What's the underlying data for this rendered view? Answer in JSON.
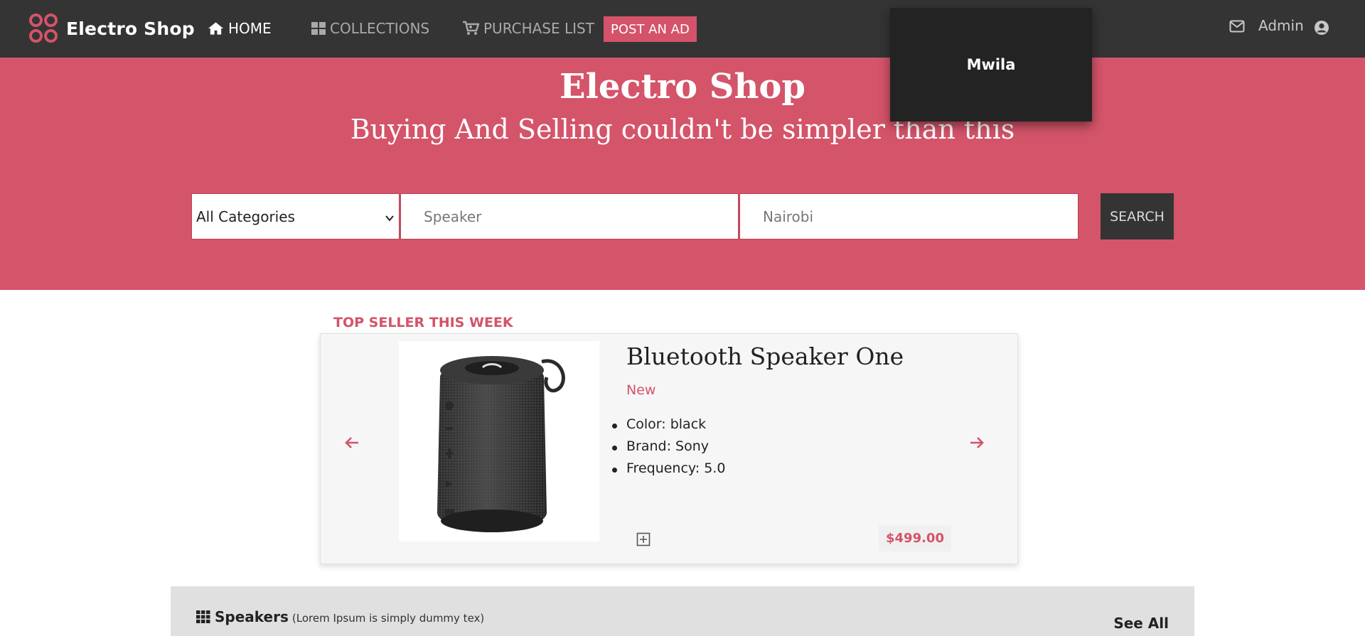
{
  "colors": {
    "accent": "#d4536a",
    "navbar": "#343434",
    "popup": "#232323"
  },
  "brand": {
    "name": "Electro Shop",
    "logo_icon": "four-circles-logo"
  },
  "nav": {
    "home": {
      "label": "HOME",
      "icon": "home-icon"
    },
    "collections": {
      "label": "COLLECTIONS",
      "icon": "grid-icon"
    },
    "purchase_list": {
      "label": "PURCHASE LIST",
      "icon": "cart-icon"
    },
    "post_ad": "POST AN AD",
    "admin": "Admin",
    "mail_icon": "mail-icon",
    "user_icon": "user-circle-icon"
  },
  "user_popup": {
    "name": "Mwila"
  },
  "hero": {
    "title": "Electro Shop",
    "subtitle": "Buying And Selling couldn't be simpler than this"
  },
  "search": {
    "category_selected": "All Categories",
    "keyword_placeholder": "Speaker",
    "location_placeholder": "Nairobi",
    "button": "SEARCH"
  },
  "top_seller": {
    "section_title": "TOP SELLER THIS WEEK",
    "product": {
      "name": "Bluetooth Speaker One",
      "condition": "New",
      "specs": [
        "Color: black",
        "Brand: Sony",
        "Frequency: 5.0"
      ],
      "price": "$499.00"
    }
  },
  "category_bar": {
    "name": "Speakers",
    "description": "(Lorem Ipsum is simply dummy tex)",
    "see_all": "See All"
  }
}
